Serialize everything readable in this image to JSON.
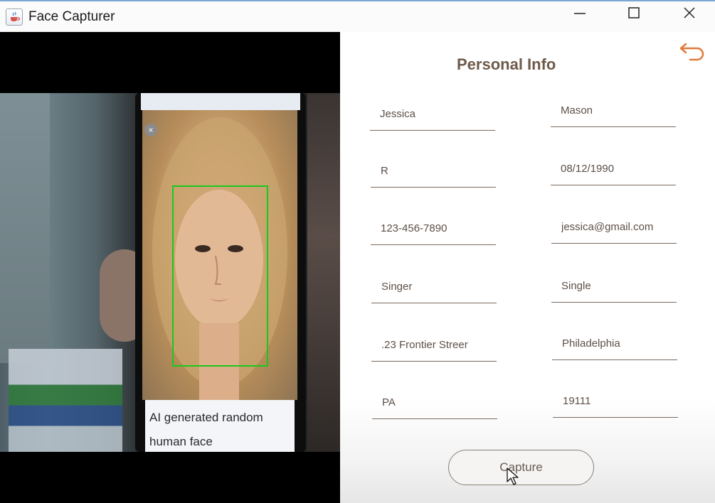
{
  "window": {
    "title": "Face Capturer",
    "icon": "java-cup-icon",
    "controls": [
      "minimize-icon",
      "maximize-icon",
      "close-icon"
    ]
  },
  "camera": {
    "phone_caption": "AI generated random human face",
    "face_box_color": "#19c81e"
  },
  "form": {
    "title": "Personal Info",
    "back_icon": "back-arrow-icon",
    "fields": [
      "Jessica",
      "Mason",
      "R",
      "08/12/1990",
      "123-456-7890",
      "jessica@gmail.com",
      "Singer",
      "Single",
      ".23 Frontier Streer",
      "Philadelphia",
      "PA",
      "19111"
    ],
    "capture_label": "Capture"
  },
  "colors": {
    "title_text": "#6e5a4a",
    "accent_back_arrow": "#e07b3a",
    "field_underline": "#7a6a5e"
  }
}
